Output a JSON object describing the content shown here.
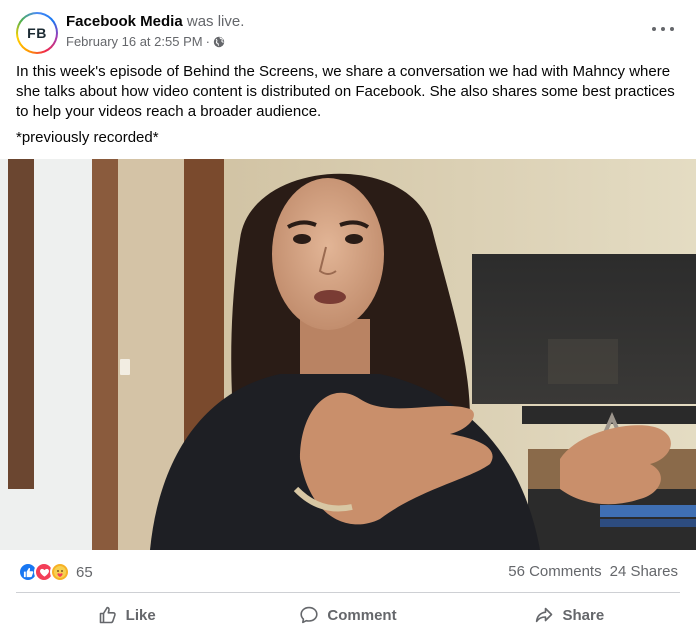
{
  "post": {
    "author": {
      "avatar_text": "FB",
      "name": "Facebook Media",
      "status": "was live."
    },
    "date": "February 16 at 2:55 PM",
    "separator": "·",
    "privacy_icon": "globe-icon",
    "body": "In this week's episode of Behind the Screens, we share a conversation we had with Mahncy where she talks about how video content is distributed on Facebook. She also shares some best practices to help your videos reach a broader audience.",
    "note": "*previously recorded*"
  },
  "engagement": {
    "reaction_icons": [
      "like-icon",
      "love-icon",
      "care-icon"
    ],
    "reaction_count": "65",
    "comments": "56 Comments",
    "shares": "24 Shares"
  },
  "actions": {
    "like_label": "Like",
    "comment_label": "Comment",
    "share_label": "Share"
  },
  "colors": {
    "brand_blue": "#1877f2",
    "love_red": "#f33e58",
    "care_yellow": "#f7b125",
    "secondary_text": "#65676b"
  }
}
